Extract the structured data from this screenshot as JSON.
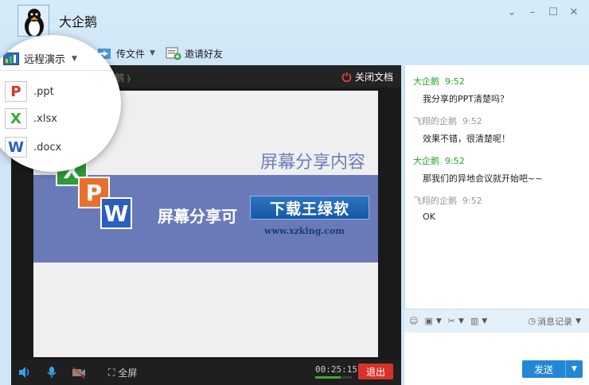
{
  "window": {
    "contact_name": "大企鹅",
    "controls": [
      "minimize-arrow",
      "minimize",
      "maximize",
      "close"
    ]
  },
  "toolbar": {
    "remote_demo": "远程演示",
    "send_file": "传文件",
    "invite_friends": "邀请好友"
  },
  "remote_menu": {
    "title": "远程演示",
    "items": [
      ".ppt",
      ".xlsx",
      ".docx"
    ]
  },
  "video": {
    "peer_name": "鹅",
    "close_doc": "关闭文档",
    "slide_title": "屏幕分享内容",
    "slide_band_text": "屏幕分享可",
    "watermark": "下载王绿软",
    "watermark_url": "www.xzking.com",
    "fullscreen": "全屏",
    "timer": "00:25:15",
    "exit": "退出"
  },
  "chat": {
    "messages": [
      {
        "sender": "大企鹅",
        "time": "9:52",
        "text": "我分享的PPT清楚吗？",
        "color": "#2aa32a"
      },
      {
        "sender": "飞翔的企鹅",
        "time": "9:52",
        "text": "效果不错，很清楚呢！",
        "color": "#999999"
      },
      {
        "sender": "大企鹅",
        "time": "9:52",
        "text": "那我们的异地会议就开始吧~~",
        "color": "#2aa32a"
      },
      {
        "sender": "飞翔的企鹅",
        "time": "9:52",
        "text": "OK",
        "color": "#999999"
      }
    ],
    "history": "消息记录",
    "send": "发送"
  },
  "colors": {
    "accent": "#2288d6",
    "exit": "#d8332a",
    "self_name": "#2aa32a",
    "peer_name": "#999999"
  }
}
